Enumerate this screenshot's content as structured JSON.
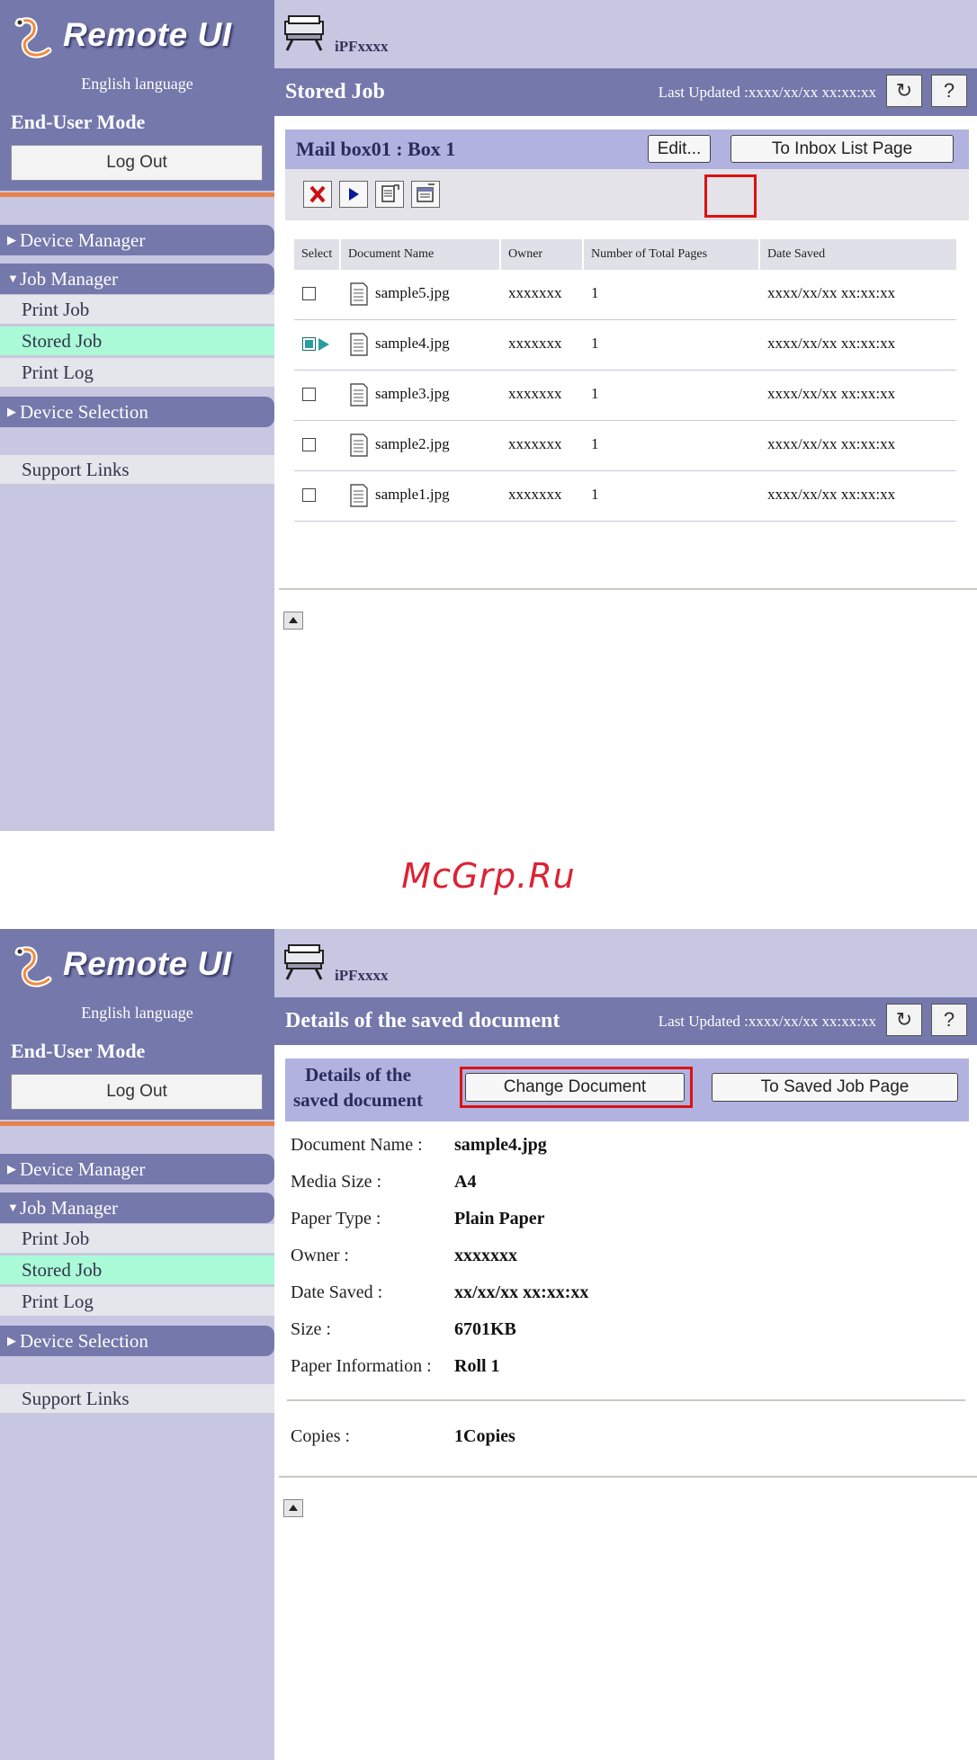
{
  "watermark": "McGrp.Ru",
  "common": {
    "app_name": "Remote UI",
    "language": "English language",
    "mode": "End-User Mode",
    "logout_label": "Log Out",
    "device_name": "iPFxxxx",
    "last_updated": "Last Updated :xxxx/xx/xx xx:xx:xx",
    "help_label": "?",
    "nav": {
      "device_manager": "Device Manager",
      "job_manager": "Job Manager",
      "print_job": "Print Job",
      "stored_job": "Stored Job",
      "print_log": "Print Log",
      "device_selection": "Device Selection",
      "support_links": "Support Links"
    },
    "colors": {
      "accent": "#7478ab",
      "active_nav": "#aafad8",
      "highlight": "#dd1111"
    }
  },
  "screen1": {
    "page_title": "Stored Job",
    "box_title": "Mail box01 : Box 1",
    "edit_label": "Edit...",
    "inbox_label": "To Inbox List Page",
    "toolbar_icons": [
      "delete-icon",
      "print-icon",
      "document-details-icon",
      "edit-document-icon"
    ],
    "table": {
      "headers": [
        "Select",
        "Document Name",
        "Owner",
        "Number of Total Pages",
        "Date Saved"
      ],
      "rows": [
        {
          "name": "sample5.jpg",
          "owner": "xxxxxxx",
          "pages": "1",
          "date": "xxxx/xx/xx xx:xx:xx",
          "selected": false
        },
        {
          "name": "sample4.jpg",
          "owner": "xxxxxxx",
          "pages": "1",
          "date": "xxxx/xx/xx xx:xx:xx",
          "selected": true
        },
        {
          "name": "sample3.jpg",
          "owner": "xxxxxxx",
          "pages": "1",
          "date": "xxxx/xx/xx xx:xx:xx",
          "selected": false
        },
        {
          "name": "sample2.jpg",
          "owner": "xxxxxxx",
          "pages": "1",
          "date": "xxxx/xx/xx xx:xx:xx",
          "selected": false
        },
        {
          "name": "sample1.jpg",
          "owner": "xxxxxxx",
          "pages": "1",
          "date": "xxxx/xx/xx xx:xx:xx",
          "selected": false
        }
      ]
    }
  },
  "screen2": {
    "page_title": "Details of the saved document",
    "section_title_line1": "Details of the",
    "section_title_line2": "saved document",
    "change_label": "Change Document",
    "saved_job_label": "To Saved Job Page",
    "details": [
      {
        "label": "Document Name :",
        "value": "sample4.jpg"
      },
      {
        "label": "Media Size :",
        "value": "A4"
      },
      {
        "label": "Paper Type :",
        "value": "Plain Paper"
      },
      {
        "label": "Owner :",
        "value": "xxxxxxx"
      },
      {
        "label": "Date Saved :",
        "value": "xx/xx/xx xx:xx:xx"
      },
      {
        "label": "Size :",
        "value": "6701KB"
      },
      {
        "label": "Paper Information :",
        "value": "Roll 1"
      }
    ],
    "copies": {
      "label": "Copies :",
      "value": "1Copies"
    }
  }
}
